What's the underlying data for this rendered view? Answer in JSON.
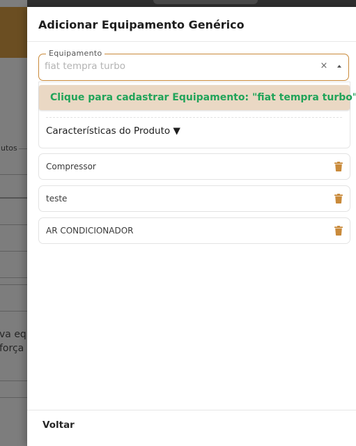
{
  "background": {
    "texts": [
      "utos",
      "va eq",
      "força"
    ]
  },
  "drawer": {
    "title": "Adicionar Equipamento Genérico",
    "field": {
      "label": "Equipamento",
      "value": "fiat tempra turbo",
      "clear_symbol": "×"
    },
    "create_option": "Clique para cadastrar Equipamento: \"fiat tempra turbo\"",
    "features_toggle": "Características do Produto ▼",
    "items": [
      {
        "label": "Compressor"
      },
      {
        "label": "teste"
      },
      {
        "label": "AR CONDICIONADOR"
      }
    ],
    "back_label": "Voltar",
    "colors": {
      "accent": "#c98a3a",
      "create_text": "#22a45a",
      "create_bg": "#ead8c4",
      "trash": "#c98a3a"
    }
  },
  "icons": {
    "clear": "close-icon",
    "dropdown": "caret-up-icon",
    "delete": "trash-icon"
  }
}
